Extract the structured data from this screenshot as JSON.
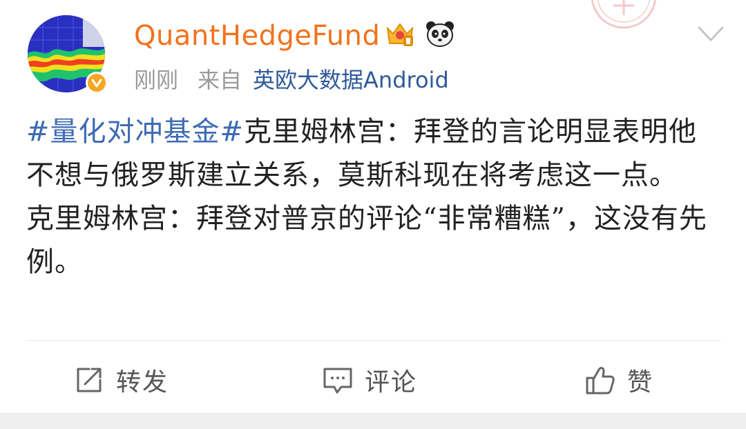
{
  "post": {
    "author": "QuantHedgeFund",
    "time": "刚刚",
    "source_prefix": "来自",
    "source": "英欧大数据Android",
    "hashtag": "#量化对冲基金#",
    "paragraph1_rest": "克里姆林宫：拜登的言论明显表明他不想与俄罗斯建立关系，莫斯科现在将考虑这一点。",
    "paragraph2": "克里姆林宫：拜登对普京的评论“非常糟糕”，这没有先例。"
  },
  "actions": {
    "repost": "转发",
    "comment": "评论",
    "like": "赞"
  },
  "colors": {
    "author": "#f2721c",
    "link": "#3d6bb3",
    "meta": "#9a9a9a",
    "text": "#222222",
    "verified": "#f5a623"
  },
  "icons": {
    "verified": "verified-badge-icon",
    "vip": "crown-vip-icon",
    "panda": "panda-icon",
    "menu": "chevron-down-icon",
    "repost": "share-square-arrow-icon",
    "comment": "comment-bubble-icon",
    "like": "thumbs-up-icon"
  }
}
